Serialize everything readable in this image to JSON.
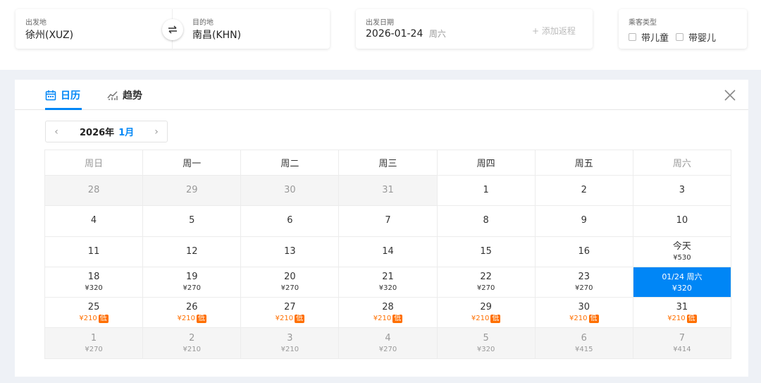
{
  "search": {
    "from": {
      "label": "出发地",
      "value": "徐州(XUZ)"
    },
    "to": {
      "label": "目的地",
      "value": "南昌(KHN)"
    },
    "swap_icon": "swap-arrows-icon",
    "date": {
      "label": "出发日期",
      "value": "2026-01-24",
      "weekday": "周六",
      "add_return": "+ 添加返程"
    },
    "passenger": {
      "label": "乘客类型",
      "options": [
        {
          "label": "带儿童",
          "checked": false
        },
        {
          "label": "带婴儿",
          "checked": false
        }
      ]
    }
  },
  "panel": {
    "tabs": [
      {
        "label": "日历",
        "icon": "calendar-icon",
        "active": true
      },
      {
        "label": "趋势",
        "icon": "trend-chart-icon",
        "active": false
      }
    ],
    "close_icon": "close-icon",
    "month_nav": {
      "year": "2026年",
      "month": "1月",
      "prev_icon": "chevron-left-icon",
      "next_icon": "chevron-right-icon"
    }
  },
  "calendar": {
    "weekdays": [
      "周日",
      "周一",
      "周二",
      "周三",
      "周四",
      "周五",
      "周六"
    ],
    "rows": [
      [
        {
          "day": "28",
          "price": "",
          "low": false,
          "muted": true
        },
        {
          "day": "29",
          "price": "",
          "low": false,
          "muted": true
        },
        {
          "day": "30",
          "price": "",
          "low": false,
          "muted": true
        },
        {
          "day": "31",
          "price": "",
          "low": false,
          "muted": true
        },
        {
          "day": "1",
          "price": "",
          "low": false,
          "muted": false
        },
        {
          "day": "2",
          "price": "",
          "low": false,
          "muted": false
        },
        {
          "day": "3",
          "price": "",
          "low": false,
          "muted": false
        }
      ],
      [
        {
          "day": "4",
          "price": "",
          "low": false,
          "muted": false
        },
        {
          "day": "5",
          "price": "",
          "low": false,
          "muted": false
        },
        {
          "day": "6",
          "price": "",
          "low": false,
          "muted": false
        },
        {
          "day": "7",
          "price": "",
          "low": false,
          "muted": false
        },
        {
          "day": "8",
          "price": "",
          "low": false,
          "muted": false
        },
        {
          "day": "9",
          "price": "",
          "low": false,
          "muted": false
        },
        {
          "day": "10",
          "price": "",
          "low": false,
          "muted": false
        }
      ],
      [
        {
          "day": "11",
          "price": "",
          "low": false,
          "muted": false
        },
        {
          "day": "12",
          "price": "",
          "low": false,
          "muted": false
        },
        {
          "day": "13",
          "price": "",
          "low": false,
          "muted": false
        },
        {
          "day": "14",
          "price": "",
          "low": false,
          "muted": false
        },
        {
          "day": "15",
          "price": "",
          "low": false,
          "muted": false
        },
        {
          "day": "16",
          "price": "",
          "low": false,
          "muted": false
        },
        {
          "day": "今天",
          "price": "¥530",
          "low": false,
          "muted": false
        }
      ],
      [
        {
          "day": "18",
          "price": "¥320",
          "low": false,
          "muted": false
        },
        {
          "day": "19",
          "price": "¥270",
          "low": false,
          "muted": false
        },
        {
          "day": "20",
          "price": "¥270",
          "low": false,
          "muted": false
        },
        {
          "day": "21",
          "price": "¥320",
          "low": false,
          "muted": false
        },
        {
          "day": "22",
          "price": "¥270",
          "low": false,
          "muted": false
        },
        {
          "day": "23",
          "price": "¥270",
          "low": false,
          "muted": false
        },
        {
          "day": "01/24 周六",
          "price": "¥320",
          "low": false,
          "muted": false,
          "selected": true
        }
      ],
      [
        {
          "day": "25",
          "price": "¥210",
          "low": true,
          "muted": false
        },
        {
          "day": "26",
          "price": "¥210",
          "low": true,
          "muted": false
        },
        {
          "day": "27",
          "price": "¥210",
          "low": true,
          "muted": false
        },
        {
          "day": "28",
          "price": "¥210",
          "low": true,
          "muted": false
        },
        {
          "day": "29",
          "price": "¥210",
          "low": true,
          "muted": false
        },
        {
          "day": "30",
          "price": "¥210",
          "low": true,
          "muted": false
        },
        {
          "day": "31",
          "price": "¥210",
          "low": true,
          "muted": false
        }
      ],
      [
        {
          "day": "1",
          "price": "¥270",
          "low": false,
          "muted": true
        },
        {
          "day": "2",
          "price": "¥210",
          "low": false,
          "muted": true
        },
        {
          "day": "3",
          "price": "¥210",
          "low": false,
          "muted": true
        },
        {
          "day": "4",
          "price": "¥270",
          "low": false,
          "muted": true
        },
        {
          "day": "5",
          "price": "¥320",
          "low": false,
          "muted": true
        },
        {
          "day": "6",
          "price": "¥415",
          "low": false,
          "muted": true
        },
        {
          "day": "7",
          "price": "¥414",
          "low": false,
          "muted": true
        }
      ]
    ],
    "low_badge": "低"
  },
  "colors": {
    "accent": "#0086f6",
    "low_price": "#ff6f00",
    "band": "#eef1f6"
  }
}
